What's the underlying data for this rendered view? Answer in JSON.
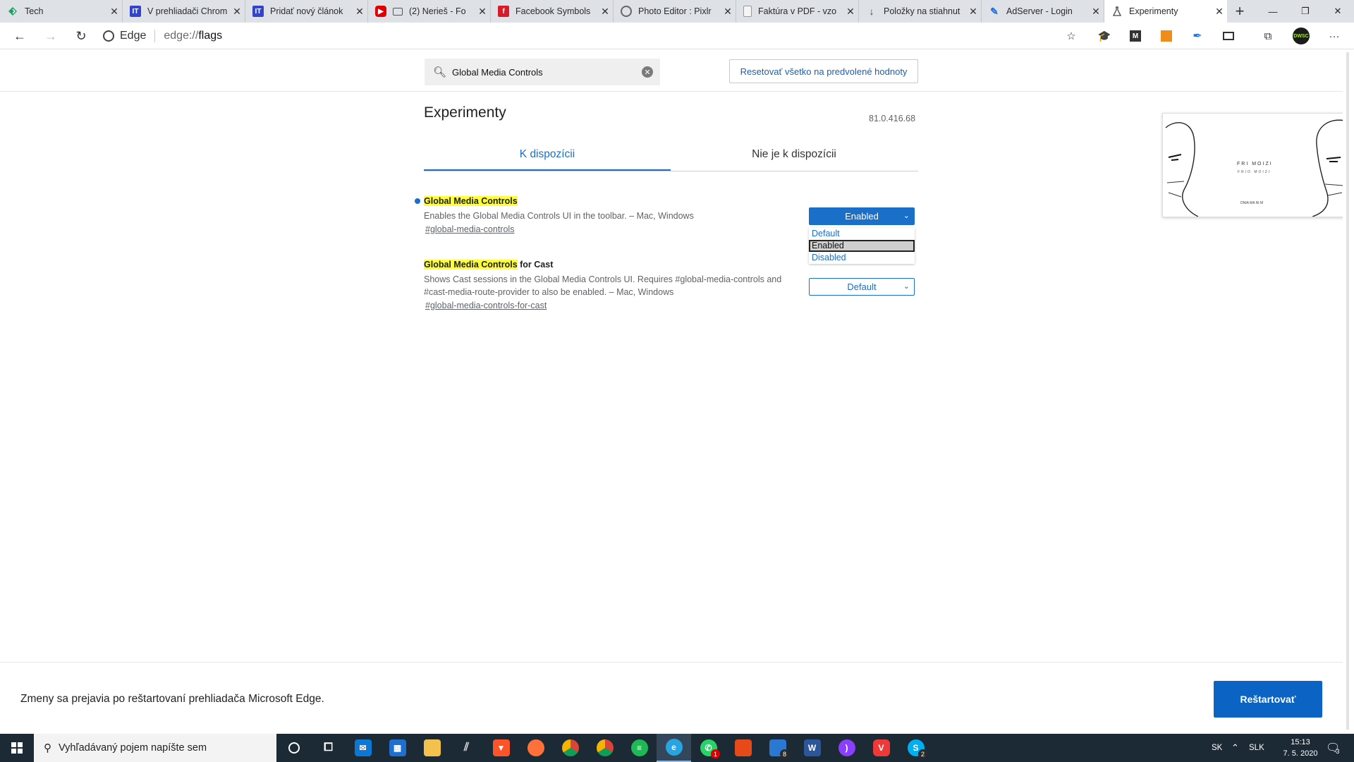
{
  "browser_tabs": [
    {
      "label": "Tech",
      "icon": "tech-favicon-icon",
      "color": "#1aa260"
    },
    {
      "label": "V prehliadači Chrom",
      "icon": "it-favicon-icon",
      "color": "#3344cc"
    },
    {
      "label": "Pridať nový článok",
      "icon": "it-favicon-icon",
      "color": "#3344cc"
    },
    {
      "label": "(2) Nerieš - Fo",
      "icon": "youtube-favicon-icon",
      "color": "#e00000"
    },
    {
      "label": "Facebook Symbols",
      "icon": "facebook-symbols-favicon-icon",
      "color": "#d81b2a"
    },
    {
      "label": "Photo Editor : Pixlr",
      "icon": "pixlr-favicon-icon",
      "color": "#666666"
    },
    {
      "label": "Faktúra v PDF - vzo",
      "icon": "document-favicon-icon",
      "color": "#888888"
    },
    {
      "label": "Položky na stiahnut",
      "icon": "download-icon",
      "color": "#444444"
    },
    {
      "label": "AdServer - Login",
      "icon": "adserver-favicon-icon",
      "color": "#1a73e8"
    },
    {
      "label": "Experimenty",
      "icon": "flask-icon",
      "color": "#444444",
      "active": true
    }
  ],
  "toolbar": {
    "omnibox_brand": "Edge",
    "url_prefix": "edge://",
    "url_path": "flags",
    "avatar_text": "DWSC"
  },
  "search": {
    "value": "Global Media Controls"
  },
  "reset_button": "Resetovať všetko na predvolené hodnoty",
  "page": {
    "title": "Experimenty",
    "version": "81.0.416.68",
    "tabs": [
      {
        "label": "K dispozícii",
        "active": true
      },
      {
        "label": "Nie je k dispozícii",
        "active": false
      }
    ]
  },
  "experiments": [
    {
      "title_highlight": "Global Media Controls",
      "title_rest": "",
      "description": "Enables the Global Media Controls UI in the toolbar. – Mac, Windows",
      "link": "#global-media-controls",
      "selected": "Enabled",
      "modified": true
    },
    {
      "title_highlight": "Global Media Controls",
      "title_rest": " for Cast",
      "description": "Shows Cast sessions in the Global Media Controls UI. Requires #global-media-controls and #cast-media-route-provider to also be enabled. – Mac, Windows",
      "link": "#global-media-controls-for-cast",
      "selected": "Default",
      "modified": false
    }
  ],
  "dropdown_options": [
    "Default",
    "Enabled",
    "Disabled"
  ],
  "preview": {
    "line1": "FRI MOIZI",
    "line2": "FRIO MOIZI",
    "line3": "DNIA MA NI M"
  },
  "bottom": {
    "message": "Zmeny sa prejavia po reštartovaní prehliadača Microsoft Edge.",
    "restart_button": "Reštartovať"
  },
  "taskbar": {
    "search_placeholder": "Vyhľadávaný pojem napíšte sem",
    "language": "SK",
    "layout": "SLK",
    "time": "15:13",
    "date": "7. 5. 2020",
    "notification_count": "3",
    "badges": {
      "whatsapp": "1",
      "notes": "8",
      "skype": "2"
    }
  },
  "colors": {
    "accent": "#1a6fc9",
    "highlight": "#ffff33",
    "restart": "#0b63c4"
  }
}
